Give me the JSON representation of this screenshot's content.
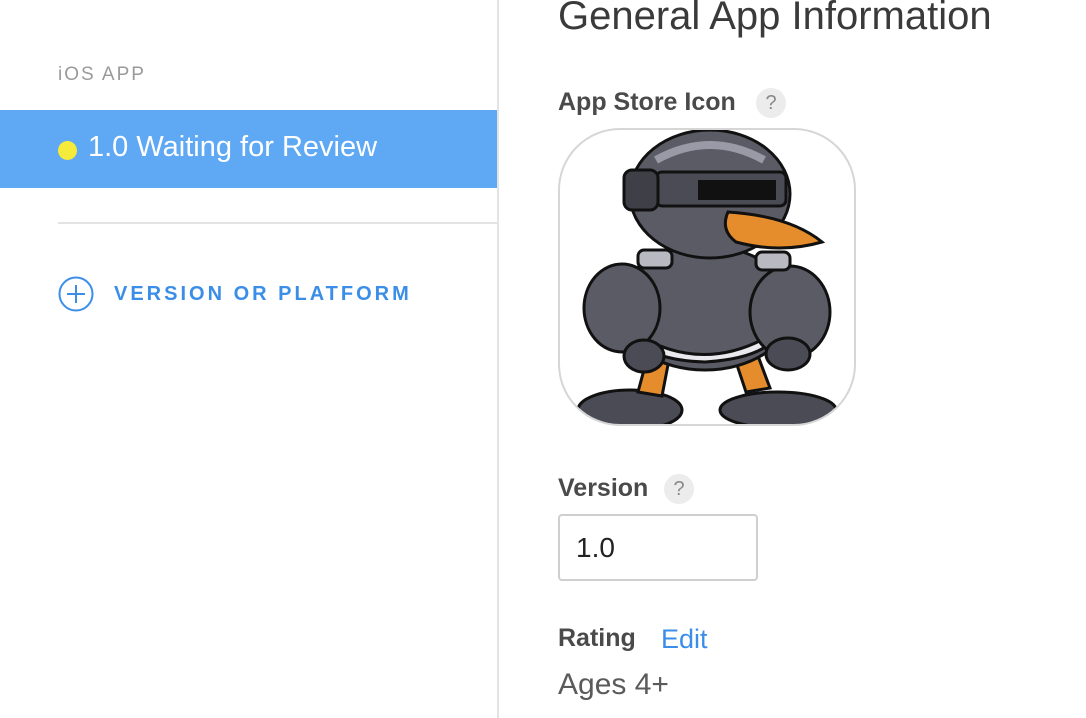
{
  "sidebar": {
    "section_label": "iOS APP",
    "versions": [
      {
        "label": "1.0 Waiting for Review",
        "status_color": "#f6ea3a",
        "selected": true
      }
    ],
    "add_label": "VERSION OR PLATFORM"
  },
  "main": {
    "title": "General App Information",
    "app_store_icon": {
      "label": "App Store Icon",
      "help": "?",
      "image": "penguin-robot-app-icon"
    },
    "version": {
      "label": "Version",
      "help": "?",
      "value": "1.0"
    },
    "rating": {
      "label": "Rating",
      "edit_label": "Edit",
      "value": "Ages 4+"
    }
  },
  "colors": {
    "selected_bg": "#5ea8f4",
    "accent": "#3b8ee8",
    "status_waiting": "#f6ea3a"
  }
}
